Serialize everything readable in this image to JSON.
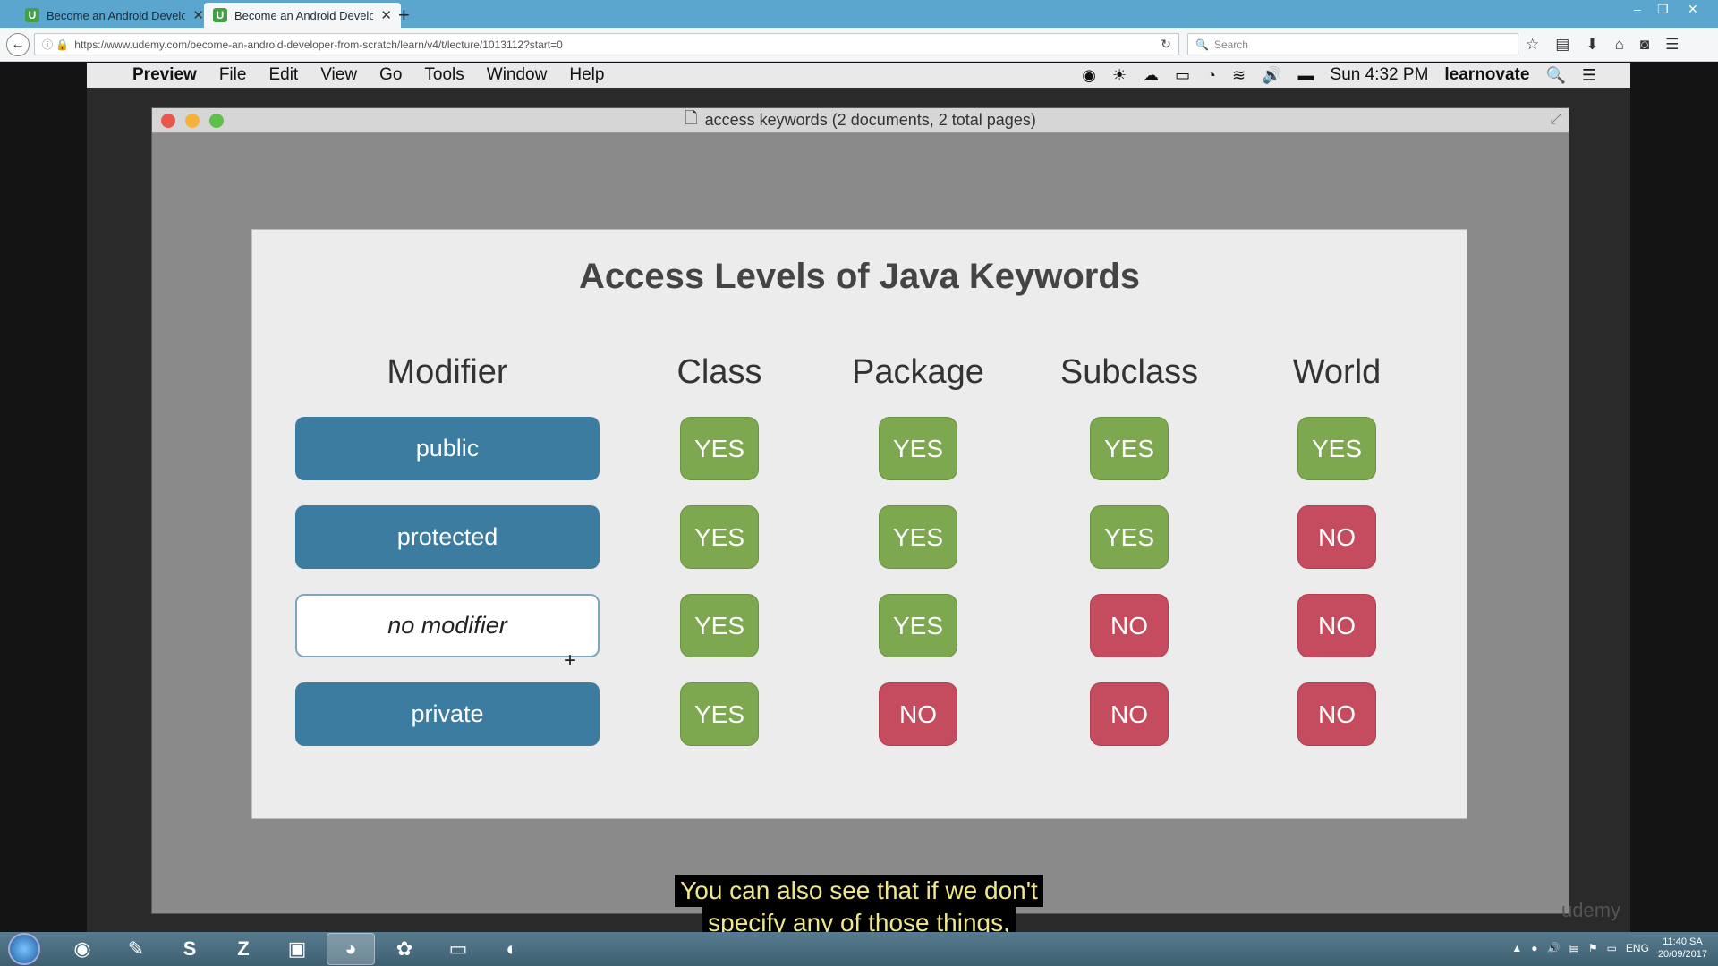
{
  "browser": {
    "tabs": [
      {
        "title": "Become an Android Develop",
        "favicon": "U"
      },
      {
        "title": "Become an Android Develop",
        "favicon": "U"
      }
    ],
    "url": "https://www.udemy.com/become-an-android-developer-from-scratch/learn/v4/t/lecture/1013112?start=0",
    "search_placeholder": "Search"
  },
  "mac": {
    "menu": {
      "app": "Preview",
      "items": [
        "File",
        "Edit",
        "View",
        "Go",
        "Tools",
        "Window",
        "Help"
      ]
    },
    "status": {
      "clock": "Sun 4:32 PM",
      "user": "learnovate"
    },
    "window_title": "access keywords (2 documents, 2 total pages)"
  },
  "slide": {
    "title": "Access Levels of Java Keywords",
    "headers": [
      "Modifier",
      "Class",
      "Package",
      "Subclass",
      "World"
    ],
    "rows": [
      {
        "modifier": "public",
        "values": [
          "YES",
          "YES",
          "YES",
          "YES"
        ]
      },
      {
        "modifier": "protected",
        "values": [
          "YES",
          "YES",
          "YES",
          "NO"
        ]
      },
      {
        "modifier": "no modifier",
        "values": [
          "YES",
          "YES",
          "NO",
          "NO"
        ]
      },
      {
        "modifier": "private",
        "values": [
          "YES",
          "NO",
          "NO",
          "NO"
        ]
      }
    ]
  },
  "caption": {
    "line1": "You can also see that if we don't",
    "line2": "specify any of those things,"
  },
  "watermark": "udemy",
  "taskbar": {
    "language": "ENG",
    "time": "11:40 SA",
    "date": "20/09/2017"
  }
}
